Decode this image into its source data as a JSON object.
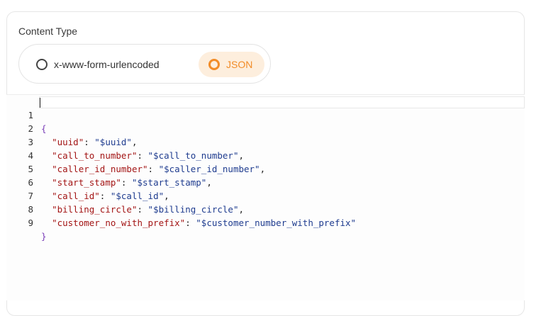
{
  "section": {
    "title": "Content Type"
  },
  "content_type": {
    "options": [
      {
        "label": "x-www-form-urlencoded",
        "selected": false
      },
      {
        "label": "JSON",
        "selected": true
      }
    ]
  },
  "editor": {
    "lines": [
      {
        "n": "1",
        "open": "{"
      },
      {
        "n": "2",
        "key": "\"uuid\"",
        "val": "\"$uuid\"",
        "comma": ","
      },
      {
        "n": "3",
        "key": "\"call_to_number\"",
        "val": "\"$call_to_number\"",
        "comma": ","
      },
      {
        "n": "4",
        "key": "\"caller_id_number\"",
        "val": "\"$caller_id_number\"",
        "comma": ","
      },
      {
        "n": "5",
        "key": "\"start_stamp\"",
        "val": "\"$start_stamp\"",
        "comma": ","
      },
      {
        "n": "6",
        "key": "\"call_id\"",
        "val": "\"$call_id\"",
        "comma": ","
      },
      {
        "n": "7",
        "key": "\"billing_circle\"",
        "val": "\"$billing_circle\"",
        "comma": ","
      },
      {
        "n": "8",
        "key": "\"customer_no_with_prefix\"",
        "val": "\"$customer_number_with_prefix\"",
        "comma": ""
      },
      {
        "n": "9",
        "close": "}"
      }
    ]
  },
  "colors": {
    "accent": "#f28c28",
    "accent_bg": "#fdeedd",
    "key": "#a31515",
    "value": "#1f3c8f",
    "brace": "#7a3db8"
  }
}
